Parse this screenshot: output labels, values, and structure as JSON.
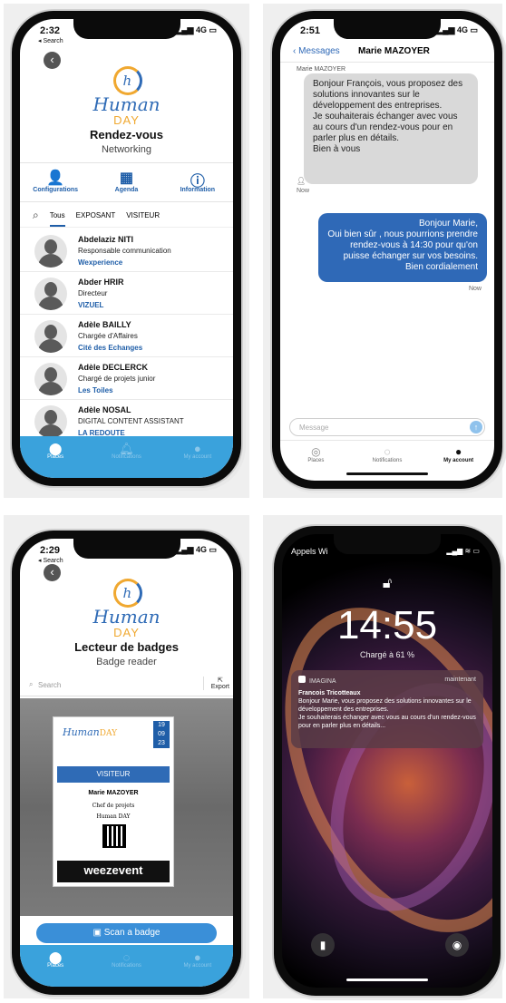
{
  "p1": {
    "time": "2:32",
    "back_label": "◂ Search",
    "signal": "4G",
    "logo_human": "Human",
    "logo_day": "DAY",
    "title": "Rendez-vous",
    "subtitle": "Networking",
    "menu": [
      {
        "icon": "users-icon",
        "label": "Configurations"
      },
      {
        "icon": "calendar-icon",
        "label": "Agenda"
      },
      {
        "icon": "info-icon",
        "label": "Information"
      }
    ],
    "tabs": [
      "Tous",
      "EXPOSANT",
      "VISITEUR"
    ],
    "contacts": [
      {
        "name": "Abdelaziz NITI",
        "role": "Responsable communication",
        "company": "Wexperience"
      },
      {
        "name": "Abder HRIR",
        "role": "Directeur",
        "company": "VIZUEL"
      },
      {
        "name": "Adèle BAILLY",
        "role": "Chargée d'Affaires",
        "company": "Cité des Echanges"
      },
      {
        "name": "Adèle DECLERCK",
        "role": "Chargé de projets junior",
        "company": "Les Toiles"
      },
      {
        "name": "Adèle NOSAL",
        "role": "DIGITAL CONTENT ASSISTANT",
        "company": "LA REDOUTE"
      }
    ],
    "nav": [
      "Places",
      "Notifications",
      "My account"
    ]
  },
  "p2": {
    "time": "2:51",
    "signal": "4G",
    "back": "Messages",
    "contact": "Marie MAZOYER",
    "sender_label": "Marie MAZOYER",
    "incoming": "Bonjour François, vous proposez des solutions innovantes sur le développement des entreprises.\nJe souhaiterais échanger avec vous au cours d'un rendez-vous pour en parler plus en détails.\nBien à vous",
    "incoming_time": "Now",
    "outgoing": "Bonjour Marie,\nOui bien sûr , nous pourrions prendre rendez-vous à 14:30 pour qu'on puisse échanger sur vos besoins.\nBien cordialement",
    "outgoing_time": "Now",
    "placeholder": "Message",
    "nav": [
      "Places",
      "Notifications",
      "My account"
    ]
  },
  "p3": {
    "time": "2:29",
    "back_label": "◂ Search",
    "signal": "4G",
    "logo_human": "Human",
    "logo_day": "DAY",
    "title": "Lecteur de badges",
    "subtitle": "Badge reader",
    "search_placeholder": "Search",
    "export": "Export",
    "badge_role": "VISITEUR",
    "badge_name": "Marie MAZOYER",
    "badge_job": "Chef de projets",
    "badge_company": "Human DAY",
    "badge_date": [
      "19",
      "09",
      "23"
    ],
    "badge_footer": "weezevent",
    "scan_label": "Scan a badge",
    "nav": [
      "Places",
      "Notifications",
      "My account"
    ]
  },
  "p4": {
    "carrier": "Appels Wi",
    "time": "14:55",
    "charge": "Chargé à 61 %",
    "app": "IMAGINA",
    "when": "maintenant",
    "sender": "Francois Tricotteaux",
    "body": "Bonjour Marie, vous proposez des solutions innovantes sur le développement des entreprises.\nJe souhaiterais échanger avec vous au cours d'un rendez-vous pour en parler plus en détails..."
  }
}
